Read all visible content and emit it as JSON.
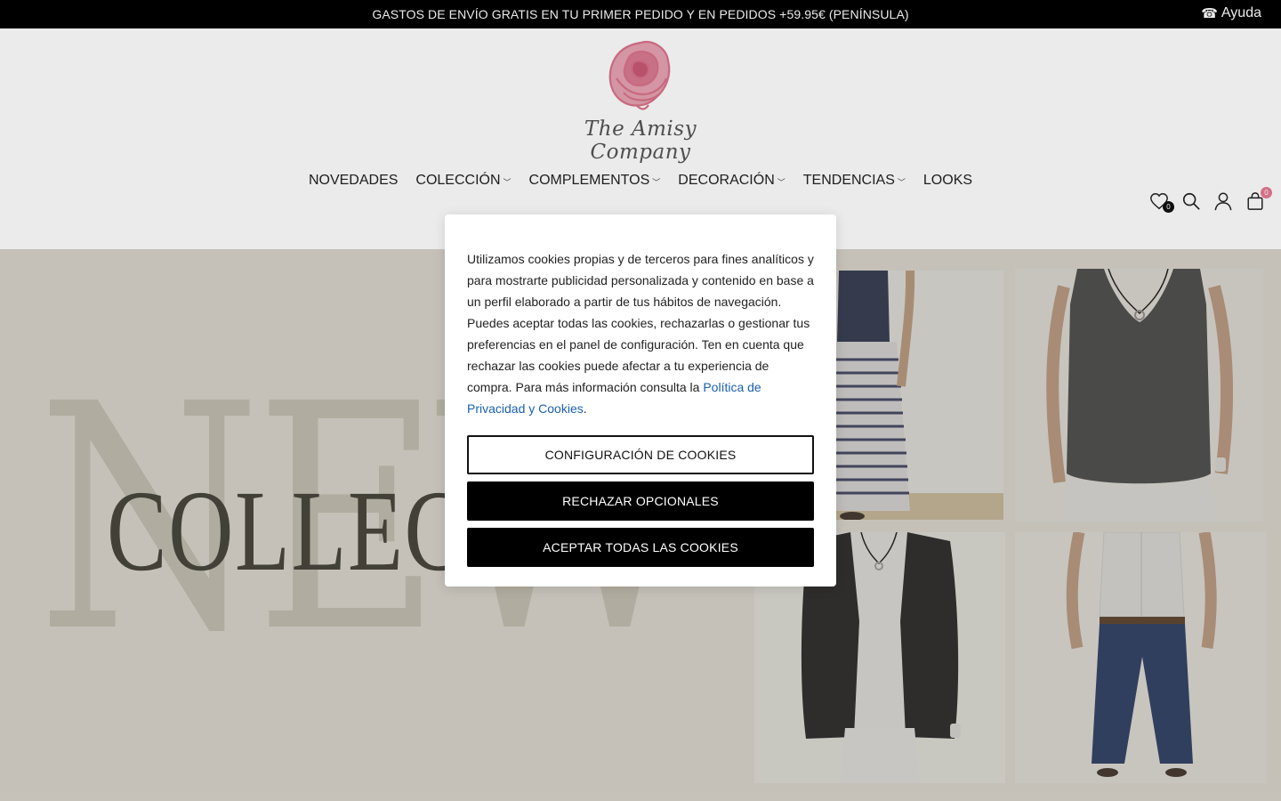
{
  "topbar": {
    "promo": "GASTOS DE ENVÍO GRATIS EN TU PRIMER PEDIDO Y EN PEDIDOS +59.95€ (PENÍNSULA)",
    "help_icon": "☎",
    "help_label": "Ayuda"
  },
  "brand": {
    "name": "The Amisy Company"
  },
  "nav": {
    "items": [
      {
        "label": "NOVEDADES",
        "dropdown": false
      },
      {
        "label": "COLECCIÓN",
        "dropdown": true
      },
      {
        "label": "COMPLEMENTOS",
        "dropdown": true
      },
      {
        "label": "DECORACIÓN",
        "dropdown": true
      },
      {
        "label": "TENDENCIAS",
        "dropdown": true
      },
      {
        "label": "LOOKS",
        "dropdown": false
      }
    ]
  },
  "header_icons": {
    "wishlist_count": "0",
    "cart_count": "0"
  },
  "hero": {
    "big_word": "NEW",
    "word": "COLLECTION"
  },
  "cookie_modal": {
    "text_main": "Utilizamos cookies propias y de terceros para fines analíticos y para mostrarte publicidad personalizada y contenido en base a un perfil elaborado a partir de tus hábitos de navegación. Puedes aceptar todas las cookies, rechazarlas o gestionar tus preferencias en el panel de configuración. Ten en cuenta que rechazar las cookies puede afectar a tu experiencia de compra. Para más información consulta la ",
    "link": "Política de Privacidad y Cookies",
    "text_end": ".",
    "btn_config": "CONFIGURACIÓN DE COOKIES",
    "btn_reject": "RECHAZAR OPCIONALES",
    "btn_accept": "ACEPTAR TODAS LAS COOKIES"
  },
  "colors": {
    "accent_pink": "#e77a95",
    "link_blue": "#1a5fad",
    "topbar_bg": "#000000"
  }
}
